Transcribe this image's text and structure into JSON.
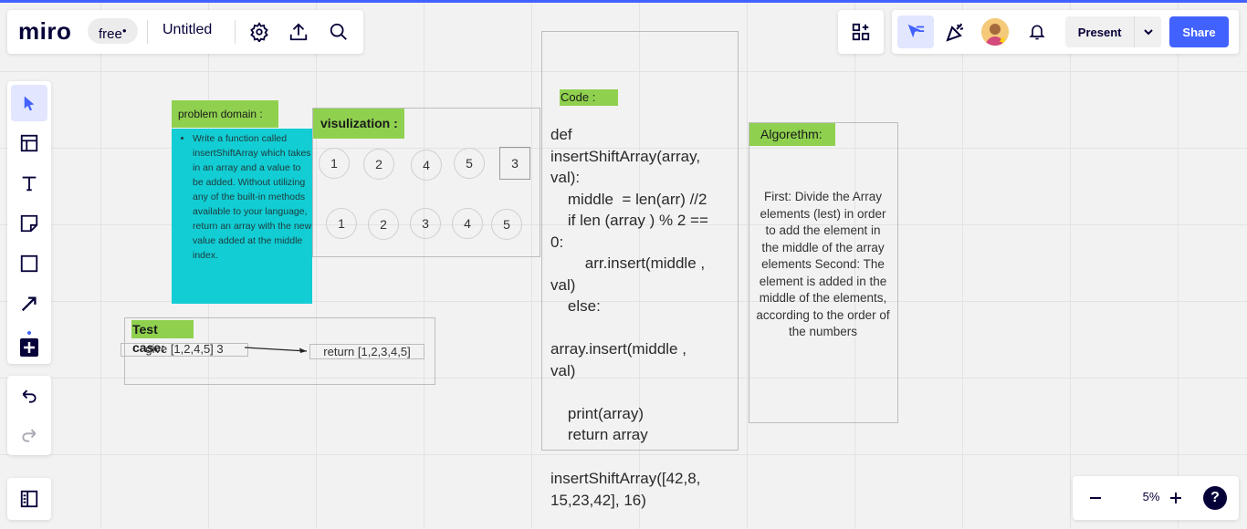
{
  "top_left": {
    "logo": "miro",
    "plan": "free",
    "board_name": "Untitled"
  },
  "top_right": {
    "present_label": "Present",
    "share_label": "Share"
  },
  "zoom": {
    "value": "5%",
    "help": "?"
  },
  "board": {
    "problem_domain": {
      "title": "problem domain :",
      "bullet": "Write a function called insertShiftArray which takes in an array and a value to be added. Without utilizing any of the built-in methods available to your language, return an array with the new value added at the middle index."
    },
    "visualization": {
      "title": "visulization :",
      "row1": [
        "1",
        "2",
        "4",
        "5"
      ],
      "row1_square": "3",
      "row2": [
        "1",
        "2",
        "3",
        "4",
        "5"
      ]
    },
    "test_case": {
      "title": "Test case:",
      "input": "give [1,2,4,5] 3",
      "output": "return [1,2,3,4,5]"
    },
    "code": {
      "title": "Code :",
      "body": "def\ninsertShiftArray(array,\nval):\n    middle  = len(arr) //2\n    if len (array ) % 2 ==\n0:\n        arr.insert(middle ,\nval)\n    else:\n\narray.insert(middle ,\nval)\n\n    print(array)\n    return array",
      "call": "insertShiftArray([42,8,\n15,23,42], 16)"
    },
    "algorithm": {
      "title": "Algorethm:",
      "body": "First: Divide the Array elements (lest) in order to add the element in the middle of the array elements Second: The element is added in the middle of the elements, according to the order of the numbers"
    }
  }
}
